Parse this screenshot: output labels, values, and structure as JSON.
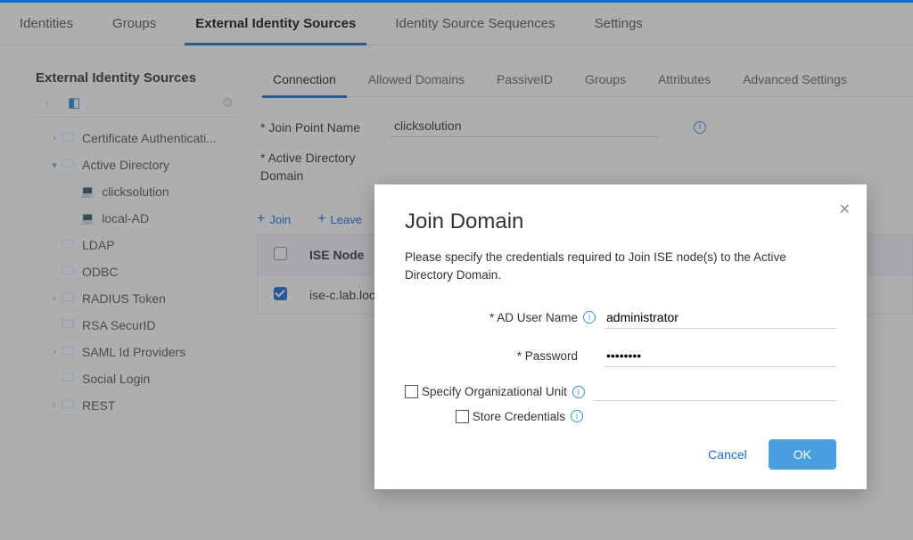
{
  "topnav": {
    "tabs": [
      "Identities",
      "Groups",
      "External Identity Sources",
      "Identity Source Sequences",
      "Settings"
    ],
    "active": 2
  },
  "sidebar": {
    "title": "External Identity Sources",
    "items": [
      {
        "label": "Certificate Authenticati...",
        "expandable": true,
        "expanded": false,
        "level": 1,
        "icon": "folder"
      },
      {
        "label": "Active Directory",
        "expandable": true,
        "expanded": true,
        "level": 1,
        "icon": "folder"
      },
      {
        "label": "clicksolution",
        "expandable": false,
        "level": 2,
        "icon": "node"
      },
      {
        "label": "local-AD",
        "expandable": false,
        "level": 2,
        "icon": "node"
      },
      {
        "label": "LDAP",
        "expandable": false,
        "level": 1,
        "icon": "folder"
      },
      {
        "label": "ODBC",
        "expandable": false,
        "level": 1,
        "icon": "folder"
      },
      {
        "label": "RADIUS Token",
        "expandable": true,
        "expanded": false,
        "level": 1,
        "icon": "folder"
      },
      {
        "label": "RSA SecurID",
        "expandable": false,
        "level": 1,
        "icon": "folder"
      },
      {
        "label": "SAML Id Providers",
        "expandable": true,
        "expanded": false,
        "level": 1,
        "icon": "folder"
      },
      {
        "label": "Social Login",
        "expandable": false,
        "level": 1,
        "icon": "folder"
      },
      {
        "label": "REST",
        "expandable": true,
        "expanded": false,
        "level": 1,
        "icon": "folder"
      }
    ]
  },
  "subtabs": {
    "tabs": [
      "Connection",
      "Allowed Domains",
      "PassiveID",
      "Groups",
      "Attributes",
      "Advanced Settings"
    ],
    "active": 0
  },
  "form": {
    "join_point_label": "*  Join Point Name",
    "join_point_value": "clicksolution",
    "ad_domain_label": "*  Active Directory Domain"
  },
  "actions": {
    "join": "Join",
    "leave": "Leave"
  },
  "table": {
    "header": "ISE Node",
    "rows": [
      {
        "checked": true,
        "name": "ise-c.lab.loc"
      }
    ]
  },
  "modal": {
    "title": "Join Domain",
    "desc": "Please specify the credentials required to Join ISE node(s) to the Active Directory Domain.",
    "user_label": "* AD User Name",
    "user_value": "administrator",
    "pass_label": "* Password",
    "pass_value": "••••••••",
    "ou_label": "Specify Organizational Unit",
    "store_label": "Store Credentials",
    "cancel": "Cancel",
    "ok": "OK"
  }
}
